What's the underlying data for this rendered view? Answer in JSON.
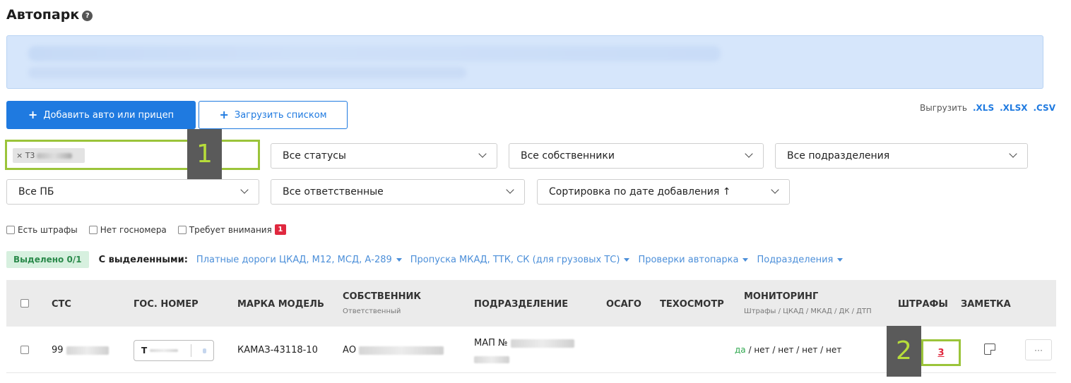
{
  "page": {
    "title": "Автопарк",
    "help_icon": "question-circle-icon"
  },
  "toolbar": {
    "add_label": "Добавить авто или прицеп",
    "upload_label": "Загрузить списком",
    "export_label": "Выгрузить",
    "export_formats": [
      ".XLS",
      ".XLSX",
      ".CSV"
    ]
  },
  "filters": {
    "search_chip_prefix": "× Т3",
    "status": "Все статусы",
    "owners": "Все собственники",
    "divisions": "Все подразделения",
    "pb": "Все ПБ",
    "responsible": "Все ответственные",
    "sort": "Сортировка по дате добавления ↑"
  },
  "checkboxes": [
    {
      "label": "Есть штрафы"
    },
    {
      "label": "Нет госномера"
    },
    {
      "label": "Требует внимания",
      "badge": "1"
    }
  ],
  "bulk": {
    "selected": "Выделено 0/1",
    "with_selected": "С выделенными:",
    "actions": [
      "Платные дороги ЦКАД, М12, МСД, А-289",
      "Пропуска МКАД, ТТК, СК (для грузовых ТС)",
      "Проверки автопарка",
      "Подразделения"
    ]
  },
  "table": {
    "headers": {
      "sts": "СТС",
      "plate": "ГОС. НОМЕР",
      "model": "МАРКА МОДЕЛЬ",
      "owner": "СОБСТВЕННИК",
      "owner_sub": "Ответственный",
      "division": "ПОДРАЗДЕЛЕНИЕ",
      "osago": "ОСАГО",
      "inspection": "ТЕХОСМОТР",
      "monitoring": "МОНИТОРИНГ",
      "monitoring_sub": "Штрафы / ЦКАД / МКАД / ДК / ДТП",
      "fines": "ШТРАФЫ",
      "note": "ЗАМЕТКА"
    },
    "rows": [
      {
        "sts": "99",
        "plate": "Т",
        "model": "КАМАЗ-43118-10",
        "owner": "АО",
        "division": "МАП №",
        "monitoring_yes": "да",
        "monitoring_rest": " / нет / нет / нет / нет",
        "fines": "3",
        "more": "···"
      }
    ]
  },
  "markers": {
    "m1": "1",
    "m2": "2"
  }
}
